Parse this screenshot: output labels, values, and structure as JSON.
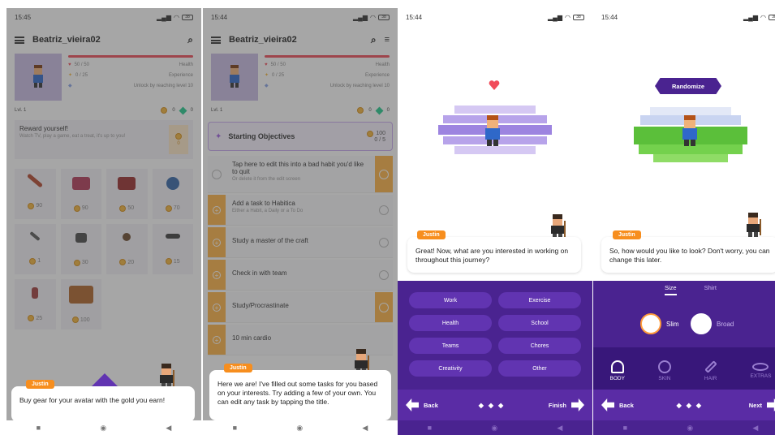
{
  "s1": {
    "status_time": "15:45",
    "battery": "38",
    "username": "Beatriz_vieira02",
    "health_value": "50 / 50",
    "health_label": "Health",
    "exp_value": "0 / 25",
    "exp_label": "Experience",
    "unlock_text": "Unlock by reaching level 10",
    "level": "Lvl. 1",
    "gold": "0",
    "gems": "0",
    "reward_title": "Reward yourself!",
    "reward_sub": "Watch TV, play a game, eat a treat, it's up to you!",
    "reward_price": "0",
    "items": [
      {
        "price": "90",
        "color": "#b4472d"
      },
      {
        "price": "90",
        "color": "#b43a5a"
      },
      {
        "price": "50",
        "color": "#9a2e2e"
      },
      {
        "price": "70",
        "color": "#3566a8"
      },
      {
        "price": "1",
        "color": "#5a5a5a"
      },
      {
        "price": "30",
        "color": "#4a4a4a"
      },
      {
        "price": "20",
        "color": "#6b4a2e"
      },
      {
        "price": "15",
        "color": "#3d3d3d"
      },
      {
        "price": "25",
        "color": "#a13d3d"
      },
      {
        "price": "100",
        "color": "#b0642a"
      }
    ],
    "speaker": "Justin",
    "bubble": "Buy gear for your avatar with the gold you earn!"
  },
  "s2": {
    "status_time": "15:44",
    "battery": "38",
    "username": "Beatriz_vieira02",
    "health_value": "50 / 50",
    "health_label": "Health",
    "exp_value": "0 / 25",
    "exp_label": "Experience",
    "unlock_text": "Unlock by reaching level 10",
    "level": "Lvl. 1",
    "gold": "0",
    "gems": "0",
    "objectives_title": "Starting Objectives",
    "objectives_reward": "100",
    "objectives_progress": "0 / 5",
    "tasks": [
      {
        "title": "Tap here to edit this into a bad habit you'd like to quit",
        "sub": "Or delete it from the edit screen"
      },
      {
        "title": "Add a task to Habitica",
        "sub": "Either a Habit, a Daily or a To Do"
      },
      {
        "title": "Study a master of the craft",
        "sub": ""
      },
      {
        "title": "Check in with team",
        "sub": ""
      },
      {
        "title": "Study/Procrastinate",
        "sub": ""
      },
      {
        "title": "10 min cardio",
        "sub": ""
      }
    ],
    "speaker": "Justin",
    "bubble": "Here we are! I've filled out some tasks for you based on your interests. Try adding a few of your own. You can edit any task by tapping the title."
  },
  "s3": {
    "status_time": "15:44",
    "battery": "38",
    "speaker": "Justin",
    "bubble": "Great! Now, what are you interested in working on throughout this journey?",
    "options": [
      "Work",
      "Exercise",
      "Health",
      "School",
      "Teams",
      "Chores",
      "Creativity",
      "Other"
    ],
    "back": "Back",
    "finish": "Finish"
  },
  "s4": {
    "status_time": "15:44",
    "battery": "38",
    "randomize": "Randomize",
    "speaker": "Justin",
    "bubble": "So, how would you like to look? Don't worry, you can change this later.",
    "tab_size": "Size",
    "tab_shirt": "Shirt",
    "slim": "Slim",
    "broad": "Broad",
    "categories": [
      "BODY",
      "SKIN",
      "HAIR",
      "EXTRAS"
    ],
    "back": "Back",
    "next": "Next"
  },
  "colors": {
    "purple": "#4a2390",
    "accent_orange": "#f78e1e",
    "health_red": "#f14c5a",
    "gold": "#f4b63c"
  }
}
